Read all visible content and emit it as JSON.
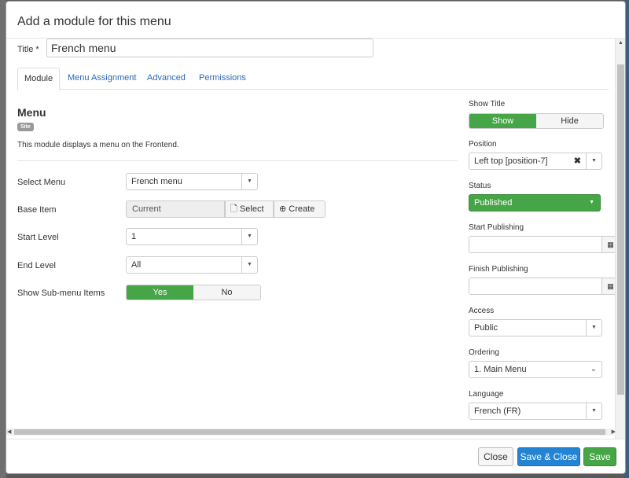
{
  "modal": {
    "title": "Add a module for this menu"
  },
  "form": {
    "title_label": "Title *",
    "title_value": "French menu"
  },
  "tabs": [
    {
      "label": "Module",
      "active": true
    },
    {
      "label": "Menu Assignment",
      "active": false
    },
    {
      "label": "Advanced",
      "active": false
    },
    {
      "label": "Permissions",
      "active": false
    }
  ],
  "module": {
    "name": "Menu",
    "badge": "Site",
    "description": "This module displays a menu on the Frontend."
  },
  "fields": {
    "select_menu": {
      "label": "Select Menu",
      "value": "French menu"
    },
    "base_item": {
      "label": "Base Item",
      "value": "Current",
      "select_label": "Select",
      "create_label": "Create"
    },
    "start_level": {
      "label": "Start Level",
      "value": "1"
    },
    "end_level": {
      "label": "End Level",
      "value": "All"
    },
    "show_submenu": {
      "label": "Show Sub-menu Items",
      "yes": "Yes",
      "no": "No",
      "selected": "Yes"
    }
  },
  "sidebar": {
    "show_title": {
      "label": "Show Title",
      "show": "Show",
      "hide": "Hide",
      "selected": "Show"
    },
    "position": {
      "label": "Position",
      "value": "Left top [position-7]"
    },
    "status": {
      "label": "Status",
      "value": "Published"
    },
    "start_publishing": {
      "label": "Start Publishing",
      "value": ""
    },
    "finish_publishing": {
      "label": "Finish Publishing",
      "value": ""
    },
    "access": {
      "label": "Access",
      "value": "Public"
    },
    "ordering": {
      "label": "Ordering",
      "value": "1. Main Menu"
    },
    "language": {
      "label": "Language",
      "value": "French (FR)"
    }
  },
  "footer": {
    "close_label": "Close",
    "save_close_label": "Save & Close",
    "save_label": "Save"
  },
  "colors": {
    "success": "#46a546",
    "primary": "#2384d3",
    "link": "#2a69b8"
  }
}
